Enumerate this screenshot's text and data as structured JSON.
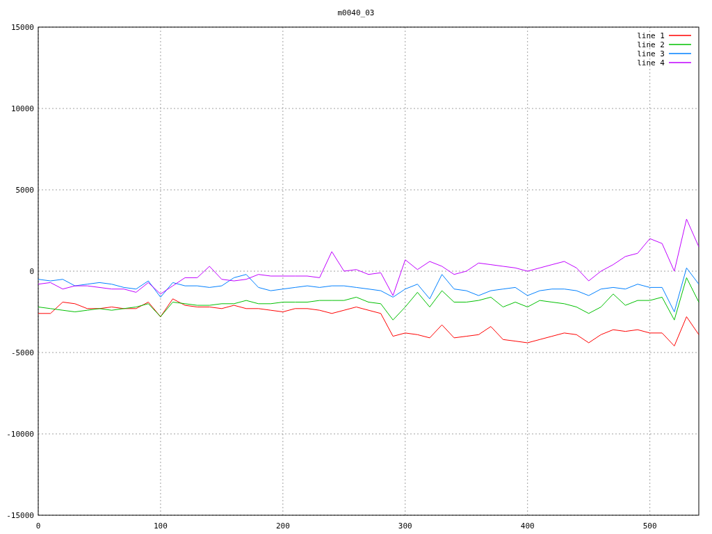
{
  "chart_data": {
    "type": "line",
    "title": "m0040_03",
    "x": [
      0,
      10,
      20,
      30,
      40,
      50,
      60,
      70,
      80,
      90,
      100,
      110,
      120,
      130,
      140,
      150,
      160,
      170,
      180,
      190,
      200,
      210,
      220,
      230,
      240,
      250,
      260,
      270,
      280,
      290,
      300,
      310,
      320,
      330,
      340,
      350,
      360,
      370,
      380,
      390,
      400,
      410,
      420,
      430,
      440,
      450,
      460,
      470,
      480,
      490,
      500,
      510,
      520,
      530,
      540
    ],
    "series": [
      {
        "name": "line 1",
        "color": "#ff0000",
        "values": [
          -2600,
          -2600,
          -1900,
          -2000,
          -2300,
          -2300,
          -2200,
          -2300,
          -2300,
          -1900,
          -2800,
          -1700,
          -2100,
          -2200,
          -2200,
          -2300,
          -2100,
          -2300,
          -2300,
          -2400,
          -2500,
          -2300,
          -2300,
          -2400,
          -2600,
          -2400,
          -2200,
          -2400,
          -2600,
          -4000,
          -3800,
          -3900,
          -4100,
          -3300,
          -4100,
          -4000,
          -3900,
          -3400,
          -4200,
          -4300,
          -4400,
          -4200,
          -4000,
          -3800,
          -3900,
          -4400,
          -3900,
          -3600,
          -3700,
          -3600,
          -3800,
          -3800,
          -4600,
          -2800,
          -3900
        ]
      },
      {
        "name": "line 2",
        "color": "#00c000",
        "values": [
          -2200,
          -2300,
          -2400,
          -2500,
          -2400,
          -2300,
          -2400,
          -2300,
          -2200,
          -2000,
          -2800,
          -1900,
          -2000,
          -2100,
          -2100,
          -2000,
          -2000,
          -1800,
          -2000,
          -2000,
          -1900,
          -1900,
          -1900,
          -1800,
          -1800,
          -1800,
          -1600,
          -1900,
          -2000,
          -3000,
          -2200,
          -1300,
          -2200,
          -1200,
          -1900,
          -1900,
          -1800,
          -1600,
          -2200,
          -1900,
          -2200,
          -1800,
          -1900,
          -2000,
          -2200,
          -2600,
          -2200,
          -1400,
          -2100,
          -1800,
          -1800,
          -1600,
          -3000,
          -400,
          -1900
        ]
      },
      {
        "name": "line 3",
        "color": "#0080ff",
        "values": [
          -500,
          -600,
          -500,
          -900,
          -800,
          -700,
          -800,
          -1000,
          -1100,
          -600,
          -1600,
          -700,
          -900,
          -900,
          -1000,
          -900,
          -400,
          -200,
          -1000,
          -1200,
          -1100,
          -1000,
          -900,
          -1000,
          -900,
          -900,
          -1000,
          -1100,
          -1200,
          -1600,
          -1100,
          -800,
          -1700,
          -200,
          -1100,
          -1200,
          -1500,
          -1200,
          -1100,
          -1000,
          -1500,
          -1200,
          -1100,
          -1100,
          -1200,
          -1500,
          -1100,
          -1000,
          -1100,
          -800,
          -1000,
          -1000,
          -2500,
          200,
          -800
        ]
      },
      {
        "name": "line 4",
        "color": "#c000ff",
        "values": [
          -800,
          -700,
          -1100,
          -900,
          -900,
          -1000,
          -1100,
          -1100,
          -1300,
          -700,
          -1400,
          -900,
          -400,
          -400,
          300,
          -500,
          -600,
          -500,
          -200,
          -300,
          -300,
          -300,
          -300,
          -400,
          1200,
          0,
          100,
          -200,
          -100,
          -1500,
          700,
          100,
          600,
          300,
          -200,
          0,
          500,
          400,
          300,
          200,
          0,
          200,
          400,
          600,
          200,
          -600,
          0,
          400,
          900,
          1100,
          2000,
          1700,
          0,
          3200,
          1500
        ]
      }
    ],
    "xlim": [
      0,
      540
    ],
    "ylim": [
      -15000,
      15000
    ],
    "xticks": [
      0,
      100,
      200,
      300,
      400,
      500
    ],
    "yticks": [
      -15000,
      -10000,
      -5000,
      0,
      5000,
      10000,
      15000
    ],
    "grid": true,
    "legend": true
  }
}
